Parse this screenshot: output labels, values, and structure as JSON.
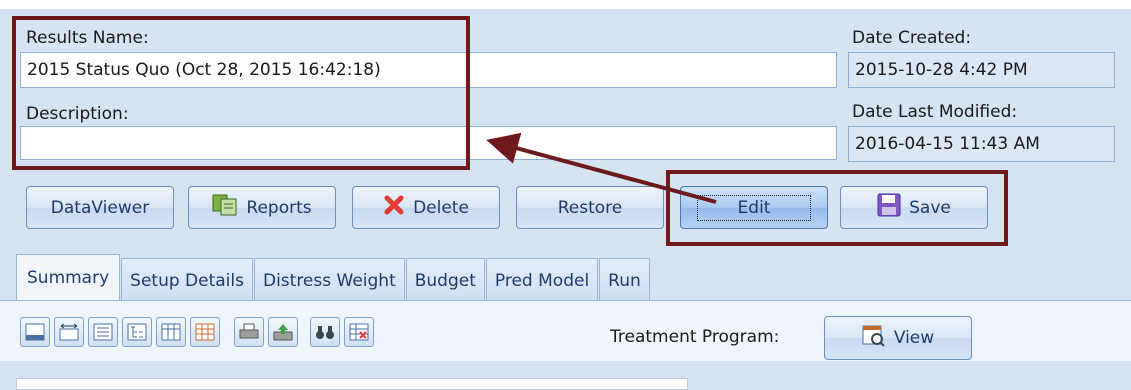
{
  "results_name": {
    "label": "Results Name:",
    "value": "2015 Status Quo (Oct 28, 2015 16:42:18)"
  },
  "description": {
    "label": "Description:",
    "value": ""
  },
  "date_created": {
    "label": "Date Created:",
    "value": "2015-10-28 4:42 PM"
  },
  "date_modified": {
    "label": "Date Last Modified:",
    "value": "2016-04-15 11:43 AM"
  },
  "buttons": {
    "dataviewer": "DataViewer",
    "reports": "Reports",
    "delete": "Delete",
    "restore": "Restore",
    "edit": "Edit",
    "save": "Save"
  },
  "tabs": [
    "Summary",
    "Setup Details",
    "Distress Weight",
    "Budget",
    "Pred Model",
    "Run"
  ],
  "treatment_program": {
    "label": "Treatment Program:",
    "button": "View"
  },
  "icons": {
    "toolbar": [
      "grid-footer-icon",
      "column-width-icon",
      "list-view-icon",
      "tree-view-icon",
      "grid-columns-icon",
      "table-icon",
      "print-icon",
      "export-icon",
      "binoculars-icon",
      "filter-grid-icon"
    ],
    "reports": "reports-icon",
    "delete": "delete-x-icon",
    "save": "floppy-disk-icon",
    "view": "view-report-icon"
  },
  "colors": {
    "annotation": "#6e1a1d",
    "background": "#d5e3f3",
    "accent": "#1e3b66"
  }
}
